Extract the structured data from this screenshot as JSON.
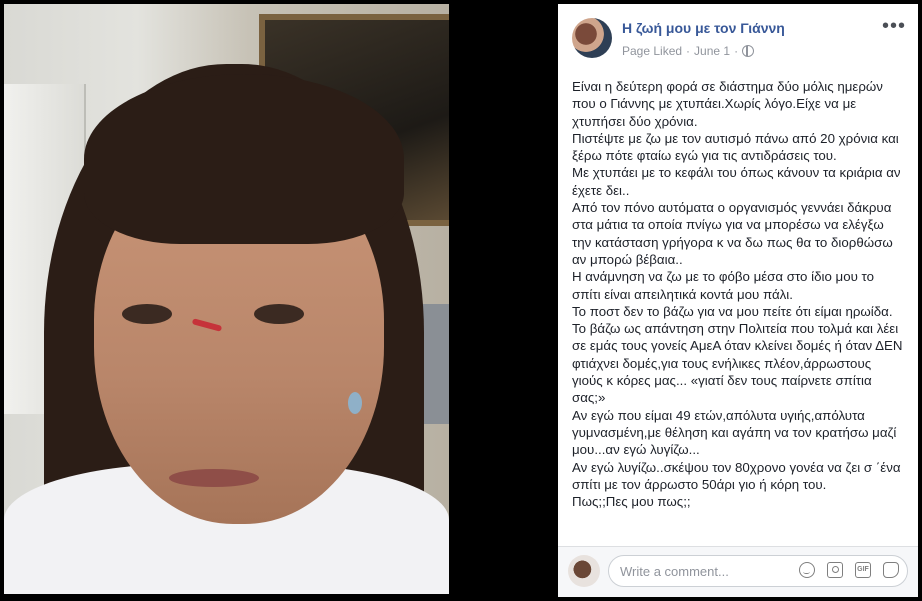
{
  "post": {
    "page_name": "Η ζωή μου με τον Γιάννη",
    "liked_status": "Page Liked",
    "separator": "·",
    "date": "June 1",
    "separator2": "·",
    "more_label": "•••",
    "body": [
      "Είναι η δεύτερη φορά σε διάστημα δύο μόλις ημερών που ο Γιάννης με χτυπάει.Χωρίς λόγο.Είχε να με χτυπήσει δύο χρόνια.",
      "Πιστέψτε με ζω με τον αυτισμό πάνω από 20 χρόνια και ξέρω πότε φταίω εγώ για τις αντιδράσεις του.",
      "Με χτυπάει με το κεφάλι του όπως κάνουν τα κριάρια αν έχετε δει..",
      "Από τον πόνο αυτόματα ο οργανισμός γεννάει δάκρυα στα μάτια τα οποία πνίγω για να μπορέσω να ελέγξω την κατάσταση γρήγορα κ να δω πως θα το διορθώσω αν μπορώ βέβαια..",
      "Η ανάμνηση να ζω με το φόβο μέσα στο ίδιο μου το σπίτι είναι απειλητικά κοντά μου πάλι.",
      "Το ποστ δεν το βάζω για να μου πείτε ότι είμαι ηρωίδα.",
      "Το βάζω ως απάντηση στην Πολιτεία που τολμά και λέει σε εμάς τους γονείς ΑμεΑ όταν κλείνει δομές ή όταν ΔΕΝ φτιάχνει δομές,για τους ενήλικες πλέον,άρρωστους γιούς κ κόρες μας... «γιατί δεν τους παίρνετε σπίτια σας;»",
      "Αν εγώ που είμαι 49 ετών,απόλυτα υγιής,απόλυτα γυμνασμένη,με θέληση και αγάπη να τον κρατήσω μαζί μου...αν εγώ λυγίζω...",
      "Αν εγώ λυγίζω..σκέψου τον 80χρονο γονέα να ζει σ ΄ένα σπίτι με τον άρρωστο 50άρι γιο ή κόρη του.",
      "Πως;;Πες μου πως;;"
    ]
  },
  "comment": {
    "placeholder": "Write a comment...",
    "gif_label": "GIF"
  },
  "icons": [
    "globe-icon",
    "more-icon",
    "smile-icon",
    "camera-icon",
    "gif-icon",
    "sticker-icon"
  ],
  "colors": {
    "page_name": "#385898",
    "meta": "#90949c",
    "text": "#1d2129",
    "background": "#000000"
  }
}
